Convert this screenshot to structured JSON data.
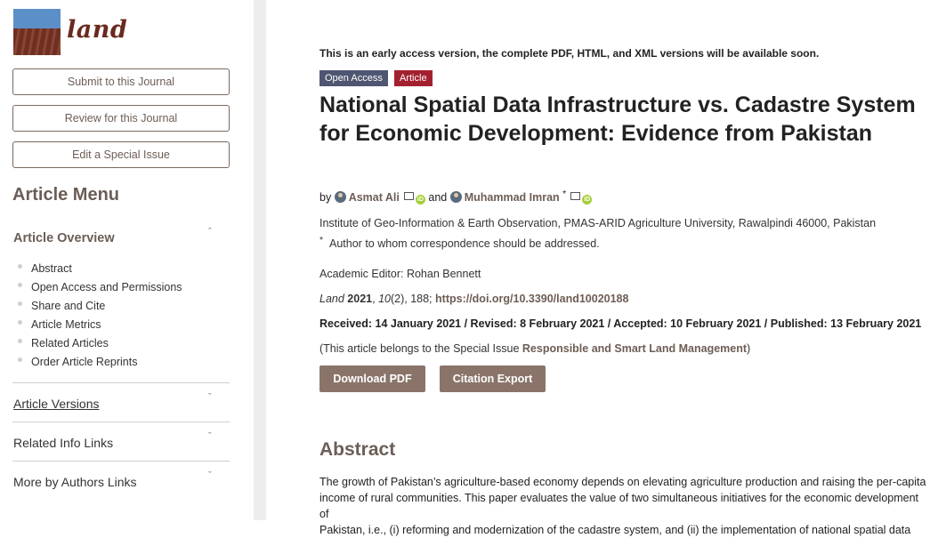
{
  "journal": {
    "logo_text": "land"
  },
  "sidebar": {
    "buttons": [
      "Submit to this Journal",
      "Review for this Journal",
      "Edit a Special Issue"
    ],
    "menu_title": "Article Menu",
    "overview_title": "Article Overview",
    "overview_items": [
      "Abstract",
      "Open Access and Permissions",
      "Share and Cite",
      "Article Metrics",
      "Related Articles",
      "Order Article Reprints"
    ],
    "sections": [
      "Article Versions",
      "Related Info Links",
      "More by Authors Links"
    ]
  },
  "article": {
    "notice": "This is an early access version, the complete PDF, HTML, and XML versions will be available soon.",
    "badges": [
      "Open Access",
      "Article"
    ],
    "title": "National Spatial Data Infrastructure vs. Cadastre System for Economic Development: Evidence from Pakistan",
    "by": "by",
    "authors": [
      "Asmat Ali",
      "Muhammad Imran"
    ],
    "and": "and",
    "corr_mark": "*",
    "affiliation": "Institute of Geo-Information & Earth Observation, PMAS-ARID Agriculture University, Rawalpindi 46000, Pakistan",
    "correspondence": "Author to whom correspondence should be addressed.",
    "editor": "Academic Editor: Rohan Bennett",
    "citation": {
      "journal": "Land",
      "year": "2021",
      "volume": "10",
      "rest": "(2), 188;",
      "doi": "https://doi.org/10.3390/land10020188"
    },
    "dates": "Received: 14 January 2021 / Revised: 8 February 2021 / Accepted: 10 February 2021 / Published: 13 February 2021",
    "special": {
      "prefix": "(This article belongs to the Special Issue ",
      "link": "Responsible and Smart Land Management",
      "suffix": ")"
    },
    "actions": [
      "Download PDF",
      "Citation Export"
    ],
    "abstract_title": "Abstract",
    "abstract_lines": [
      "The growth of Pakistan’s agriculture-based economy depends on elevating agriculture production and raising the per-capita",
      "income of rural communities. This paper evaluates the value of two simultaneous initiatives for the economic development of",
      "Pakistan, i.e., (i) reforming and modernization of the cadastre system, and (ii) the implementation of national spatial data"
    ]
  },
  "colors": {
    "accent": "#6b5e56",
    "button": "#8a7469",
    "badge_oa": "#4f5671",
    "badge_article": "#a3212f",
    "logo": "#6b2a1f"
  }
}
